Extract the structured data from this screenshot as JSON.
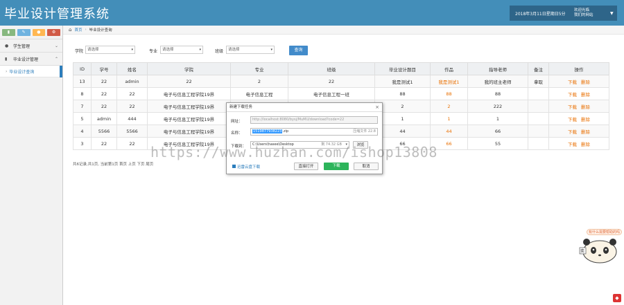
{
  "header": {
    "title": "毕业设计管理系统",
    "datetime": "2018年3月11日星期日5分",
    "user_line1": "欢迎光临",
    "user_line2": "我们的网站",
    "caret_icon": "caret-down-icon"
  },
  "sidebar": {
    "shortcut_icons": [
      "signal-icon",
      "pencil-icon",
      "users-icon",
      "cogs-icon"
    ],
    "shortcut_colors": [
      "#87b87f",
      "#6fb3e0",
      "#ffb752",
      "#d15b47"
    ],
    "items": [
      {
        "label": "学生管理",
        "icon": "user-icon"
      },
      {
        "label": "毕业设计管理",
        "icon": "bookmark-icon"
      }
    ],
    "sub_items": [
      {
        "label": "毕业设计查询"
      }
    ]
  },
  "breadcrumb": {
    "home": "首页",
    "current": "毕业设计查询"
  },
  "filters": {
    "college_label": "学院",
    "college_value": "请选择",
    "major_label": "专业",
    "major_value": "请选择",
    "class_label": "班级",
    "class_value": "请选择",
    "query_button": "查询"
  },
  "table": {
    "columns": [
      "ID",
      "学号",
      "姓名",
      "学院",
      "专业",
      "班级",
      "毕业设计题目",
      "作品",
      "指导老师",
      "备注",
      "操作"
    ],
    "rows": [
      {
        "id": "13",
        "sno": "22",
        "name": "admin",
        "college": "22",
        "major": "2",
        "clazz": "22",
        "topic": "我是测试1",
        "work": "我是测试1",
        "teacher": "我的班主老师",
        "note": "拿取",
        "dl": "下载",
        "del": "删除"
      },
      {
        "id": "8",
        "sno": "22",
        "name": "22",
        "college": "电子与信息工程学院19界",
        "major": "电子信息工程",
        "clazz": "电子信息工程一班",
        "topic": "88",
        "work": "88",
        "teacher": "88",
        "note": "",
        "dl": "下载",
        "del": "删除"
      },
      {
        "id": "7",
        "sno": "22",
        "name": "22",
        "college": "电子与信息工程学院19界",
        "major": "",
        "clazz": "",
        "topic": "2",
        "work": "2",
        "teacher": "222",
        "note": "",
        "dl": "下载",
        "del": "删除"
      },
      {
        "id": "5",
        "sno": "admin",
        "name": "444",
        "college": "电子与信息工程学院19界",
        "major": "",
        "clazz": "",
        "topic": "1",
        "work": "1",
        "teacher": "1",
        "note": "",
        "dl": "下载",
        "del": "删除"
      },
      {
        "id": "4",
        "sno": "5566",
        "name": "5566",
        "college": "电子与信息工程学院19界",
        "major": "",
        "clazz": "",
        "topic": "44",
        "work": "44",
        "teacher": "66",
        "note": "",
        "dl": "下载",
        "del": "删除"
      },
      {
        "id": "3",
        "sno": "22",
        "name": "22",
        "college": "电子与信息工程学院19界",
        "major": "",
        "clazz": "",
        "topic": "66",
        "work": "66",
        "teacher": "55",
        "note": "",
        "dl": "下载",
        "del": "删除"
      }
    ]
  },
  "pager": {
    "text": "共6记录,共1页, 当前第1页 首页 上页 下页 尾页"
  },
  "dialog": {
    "title": "新建下载任务",
    "url_label": "网址：",
    "url_value": "http://localhost:8080/bysj/MuMU/download?code=22",
    "name_label": "名称：",
    "name_selected": "1519877938223",
    "name_ext": ".zip",
    "size_text": "压缩文件 22.8",
    "path_label": "下载到：",
    "path_value": "C:\\Users\\hasee\\Desktop",
    "free_space": "剩 74.32 GB",
    "browse_button": "浏览",
    "thunder_link": "迅雷云盘下载",
    "open_button": "直接打开",
    "download_button": "下载",
    "cancel_button": "取消"
  },
  "watermark": {
    "text": "https://www.huzhan.com/ishop13808"
  },
  "widget": {
    "bubble": "有什么需要帮助的吗",
    "badge": "奕"
  }
}
